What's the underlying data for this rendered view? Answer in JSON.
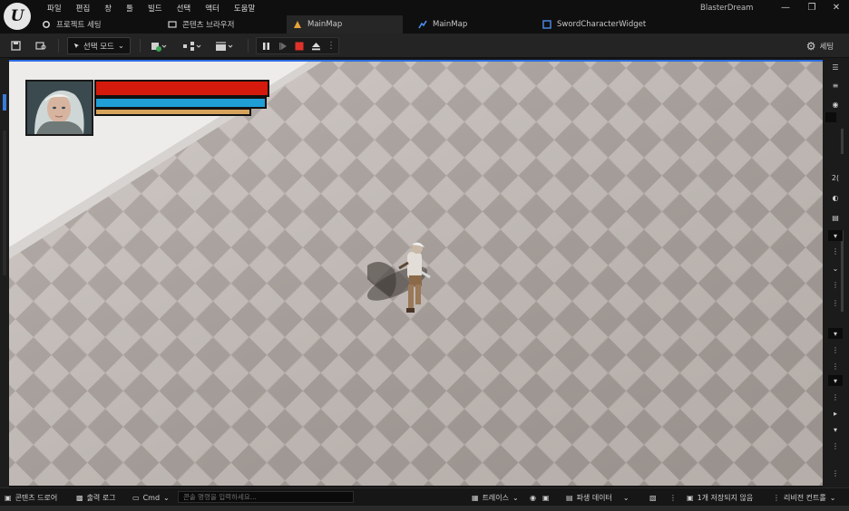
{
  "app": {
    "title": "BlasterDream"
  },
  "menu": [
    "파일",
    "편집",
    "창",
    "툴",
    "빌드",
    "선택",
    "액터",
    "도움말"
  ],
  "tabs": [
    {
      "label": "프로젝트 세팅",
      "icon": "settings-icon"
    },
    {
      "label": "콘텐츠 브라우저",
      "icon": "folder-icon"
    },
    {
      "label": "MainMap",
      "icon": "level-icon",
      "active": true
    },
    {
      "label": "MainMap",
      "icon": "blueprint-icon"
    },
    {
      "label": "SwordCharacterWidget",
      "icon": "widget-icon"
    }
  ],
  "toolbar": {
    "mode_label": "선택 모드",
    "settings_label": "세팅"
  },
  "hud": {
    "health_fraction": 1.0,
    "shield_fraction": 1.0,
    "stamina_fraction": 1.0,
    "colors": {
      "health": "#d41a0c",
      "shield": "#1f9fd6",
      "stamina": "#d7a35c"
    }
  },
  "statusbar": {
    "content_drawer": "콘텐츠 드로어",
    "output_log": "출력 로그",
    "cmd": "Cmd",
    "console_placeholder": "콘솔 명령을 입력하세요...",
    "trace": "트레이스",
    "derived_data": "파생 데이터",
    "unsaved": "1개 저장되지 않음",
    "revision_control": "리비전 컨트롤"
  },
  "colors": {
    "accent": "#2b6de0",
    "stop": "#e0322a"
  }
}
